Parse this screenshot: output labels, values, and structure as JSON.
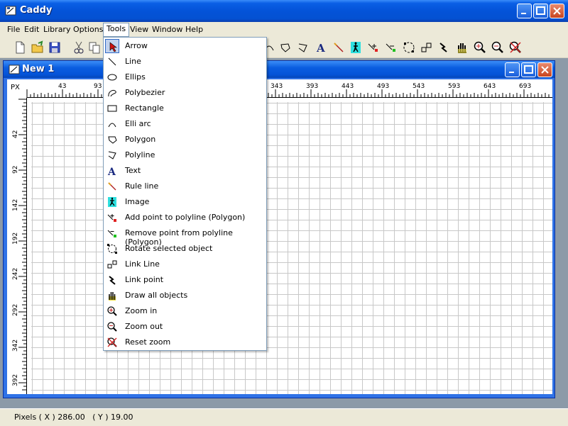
{
  "app": {
    "title": "Caddy"
  },
  "menu": [
    "File",
    "Edit",
    "Library",
    "Options",
    "Tools",
    "View",
    "Window",
    "Help"
  ],
  "document": {
    "title": "New 1"
  },
  "ruler": {
    "unit": "PX",
    "top_ticks": [
      "43",
      "93",
      "343",
      "393",
      "443",
      "493",
      "543",
      "593",
      "643",
      "693"
    ],
    "left_ticks": [
      "42",
      "92",
      "142",
      "192",
      "242",
      "292",
      "342",
      "392"
    ]
  },
  "tools_menu": {
    "items": [
      {
        "label": "Arrow",
        "icon": "arrow-icon"
      },
      {
        "label": "Line",
        "icon": "line-icon"
      },
      {
        "label": "Ellips",
        "icon": "ellipse-icon"
      },
      {
        "label": "Polybezier",
        "icon": "polybezier-icon"
      },
      {
        "label": "Rectangle",
        "icon": "rectangle-icon"
      },
      {
        "label": "Elli arc",
        "icon": "arc-icon"
      },
      {
        "label": "Polygon",
        "icon": "polygon-icon"
      },
      {
        "label": "Polyline",
        "icon": "polyline-icon"
      },
      {
        "label": "Text",
        "icon": "text-icon"
      },
      {
        "label": "Rule line",
        "icon": "rule-line-icon"
      },
      {
        "label": "Image",
        "icon": "image-icon"
      },
      {
        "label": "Add point to polyline (Polygon)",
        "icon": "add-point-icon"
      },
      {
        "label": "Remove point from polyline (Polygon)",
        "icon": "remove-point-icon"
      },
      {
        "label": "Rotate selected object",
        "icon": "rotate-icon"
      },
      {
        "label": "Link Line",
        "icon": "link-line-icon"
      },
      {
        "label": "Link point",
        "icon": "link-point-icon"
      },
      {
        "label": "Draw all objects",
        "icon": "hand-icon"
      },
      {
        "label": "Zoom in",
        "icon": "zoom-in-icon"
      },
      {
        "label": "Zoom out",
        "icon": "zoom-out-icon"
      },
      {
        "label": "Reset zoom",
        "icon": "reset-zoom-icon"
      }
    ]
  },
  "status": {
    "text": "Pixels ( X ) 286.00   ( Y ) 19.00"
  },
  "colors": {
    "title_blue": "#0453d8",
    "menu_border": "#7f9db9",
    "selection": "#c1d2ee"
  }
}
